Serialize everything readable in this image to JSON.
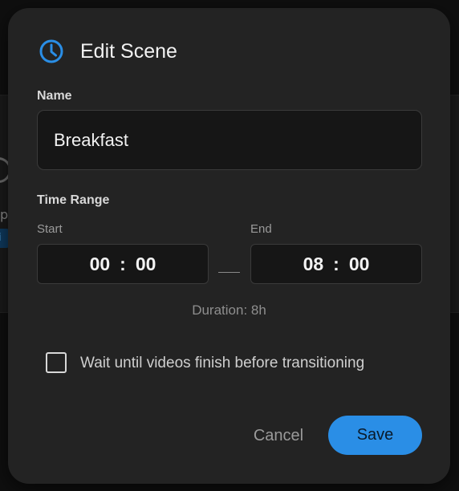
{
  "background": {
    "partial_text": "p",
    "chip_text": "i"
  },
  "dialog": {
    "title": "Edit Scene",
    "title_icon": "clock-icon",
    "accent_color": "#2a8ee6",
    "name_label": "Name",
    "name_value": "Breakfast",
    "time_range_label": "Time Range",
    "start_label": "Start",
    "start_hours": "00",
    "start_minutes": "00",
    "end_label": "End",
    "end_hours": "08",
    "end_minutes": "00",
    "time_separator": ":",
    "duration": "Duration: 8h",
    "wait_checkbox_label": "Wait until videos finish before transitioning",
    "wait_checked": false,
    "cancel_label": "Cancel",
    "save_label": "Save"
  }
}
